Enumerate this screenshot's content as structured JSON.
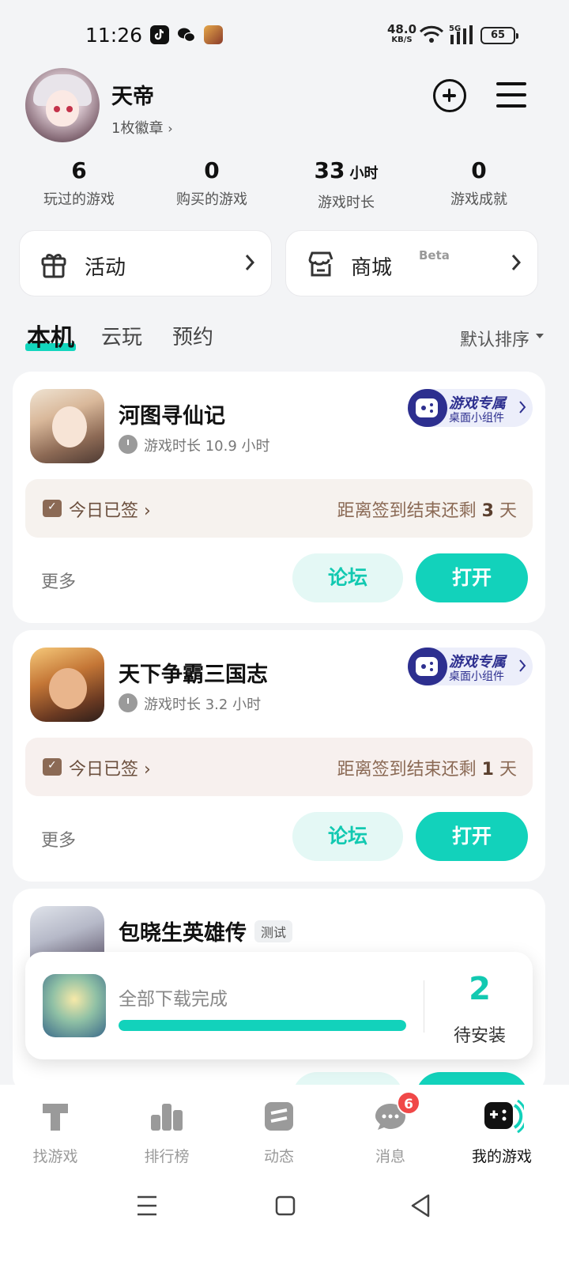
{
  "status_bar": {
    "time": "11:26",
    "speed_value": "48.0",
    "speed_unit": "KB/S",
    "network": "5G",
    "battery": "65"
  },
  "profile": {
    "username": "天帝",
    "badges": "1枚徽章"
  },
  "stats": [
    {
      "value": "6",
      "unit": "",
      "label": "玩过的游戏"
    },
    {
      "value": "0",
      "unit": "",
      "label": "购买的游戏"
    },
    {
      "value": "33",
      "unit": "小时",
      "label": "游戏时长"
    },
    {
      "value": "0",
      "unit": "",
      "label": "游戏成就"
    }
  ],
  "quick_links": {
    "activity": "活动",
    "store": "商城",
    "store_tag": "Beta"
  },
  "tabs": {
    "local": "本机",
    "cloud": "云玩",
    "reserve": "预约",
    "sort": "默认排序"
  },
  "widget": {
    "title": "游戏专属",
    "subtitle": "桌面小组件"
  },
  "games": [
    {
      "name": "河图寻仙记",
      "playtime": "游戏时长 10.9 小时",
      "signed": "今日已签",
      "remain_prefix": "距离签到结束还剩",
      "remain_days": "3",
      "remain_suffix": "天",
      "more": "更多",
      "forum": "论坛",
      "open": "打开"
    },
    {
      "name": "天下争霸三国志",
      "playtime": "游戏时长 3.2 小时",
      "signed": "今日已签",
      "remain_prefix": "距离签到结束还剩",
      "remain_days": "1",
      "remain_suffix": "天",
      "more": "更多",
      "forum": "论坛",
      "open": "打开"
    },
    {
      "name": "包晓生英雄传",
      "tag": "测试"
    }
  ],
  "download": {
    "status": "全部下载完成",
    "progress": 1.0,
    "count": "2",
    "count_label": "待安装"
  },
  "bottom_nav": [
    {
      "label": "找游戏",
      "icon": "find-game-icon"
    },
    {
      "label": "排行榜",
      "icon": "ranking-icon"
    },
    {
      "label": "动态",
      "icon": "feed-icon"
    },
    {
      "label": "消息",
      "icon": "message-icon",
      "badge": "6"
    },
    {
      "label": "我的游戏",
      "icon": "my-games-icon"
    }
  ],
  "colors": {
    "accent": "#12d2bb",
    "accent_light": "#e4f8f5",
    "badge_red": "#f04848",
    "widget_blue": "#2d2f8f"
  }
}
